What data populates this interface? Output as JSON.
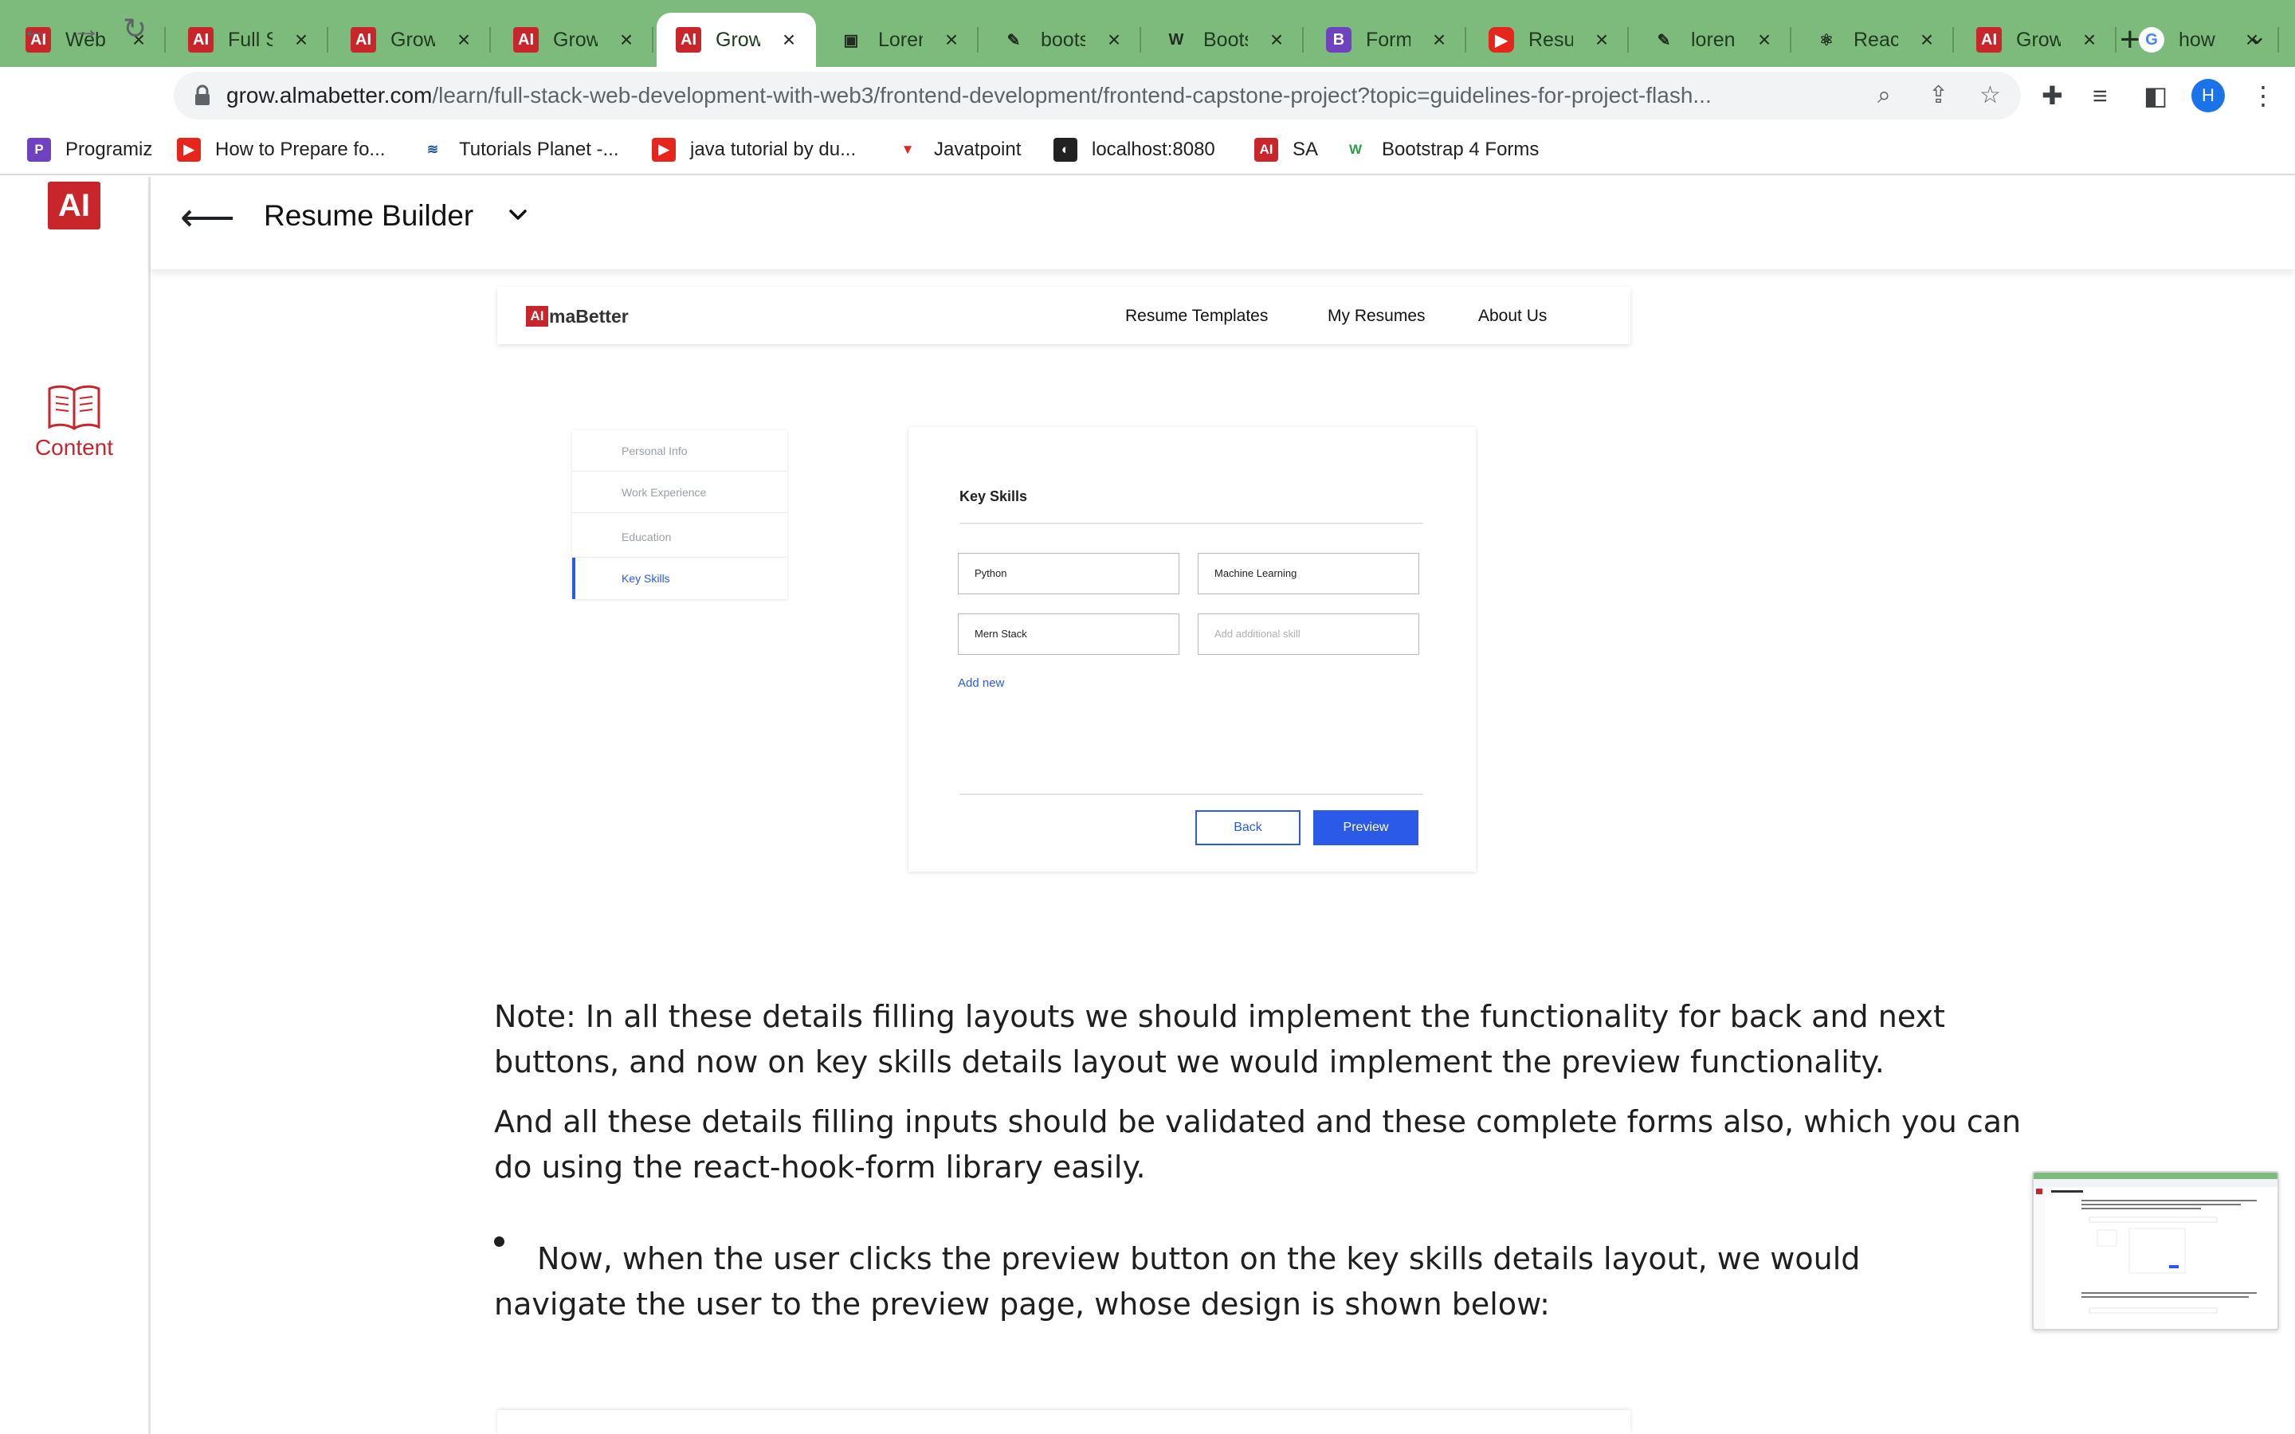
{
  "browser": {
    "tabs": [
      {
        "title": "Web",
        "favicon": "almabetter-icon",
        "fav_text": "AI"
      },
      {
        "title": "Full S",
        "favicon": "almabetter-icon",
        "fav_text": "AI"
      },
      {
        "title": "Grow",
        "favicon": "almabetter-icon",
        "fav_text": "AI"
      },
      {
        "title": "Grow",
        "favicon": "almabetter-icon",
        "fav_text": "AI"
      },
      {
        "title": "Grow",
        "favicon": "almabetter-icon",
        "fav_text": "AI",
        "active": true
      },
      {
        "title": "Loren",
        "favicon": "image-icon",
        "fav_text": "▣"
      },
      {
        "title": "boots",
        "favicon": "pen-icon",
        "fav_text": "✎"
      },
      {
        "title": "Boots",
        "favicon": "w3-icon",
        "fav_text": "W"
      },
      {
        "title": "Form",
        "favicon": "bootstrap-icon",
        "fav_text": "B"
      },
      {
        "title": "Resu",
        "favicon": "youtube-icon",
        "fav_text": "▶"
      },
      {
        "title": "loren",
        "favicon": "pen-icon",
        "fav_text": "✎"
      },
      {
        "title": "Reac",
        "favicon": "react-icon",
        "fav_text": "⚛"
      },
      {
        "title": "Grow",
        "favicon": "almabetter-icon",
        "fav_text": "AI"
      },
      {
        "title": "how",
        "favicon": "google-icon",
        "fav_text": "G"
      }
    ],
    "new_tab_glyph": "+",
    "url_host": "grow.almabetter.com",
    "url_path": "/learn/full-stack-web-development-with-web3/frontend-development/frontend-capstone-project?topic=guidelines-for-project-flash...",
    "profile_initial": "H",
    "bookmarks": [
      {
        "label": "Programiz",
        "icon": "programiz-icon"
      },
      {
        "label": "How to Prepare fo...",
        "icon": "youtube-icon"
      },
      {
        "label": "Tutorials Planet -...",
        "icon": "tutorials-planet-icon"
      },
      {
        "label": "java tutorial by du...",
        "icon": "youtube-icon"
      },
      {
        "label": "Javatpoint",
        "icon": "javatpoint-icon"
      },
      {
        "label": "localhost:8080",
        "icon": "globe-icon"
      },
      {
        "label": "SA",
        "icon": "almabetter-icon"
      },
      {
        "label": "Bootstrap 4 Forms",
        "icon": "w3-icon"
      }
    ]
  },
  "sidebar": {
    "logo_text": "AI",
    "content_label": "Content"
  },
  "header": {
    "title": "Resume Builder"
  },
  "mockup": {
    "logo_badge": "AI",
    "logo_text": "maBetter",
    "nav_links": [
      "Resume Templates",
      "My Resumes",
      "About Us"
    ],
    "steps": [
      "Personal Info",
      "Work Experience",
      "Education",
      "Key Skills"
    ],
    "card_title": "Key Skills",
    "skills": [
      "Python",
      "Machine Learning",
      "Mern Stack"
    ],
    "skill_placeholder": "Add additional skill",
    "add_new": "Add new",
    "back_label": "Back",
    "preview_label": "Preview"
  },
  "article": {
    "note": "Note: In all these details filling layouts we should implement the functionality for back and next buttons, and now on key skills details layout we would implement the preview functionality.",
    "validation": "And all these details filling inputs should be validated and these complete forms also, which you can do using the react-hook-form library easily.",
    "bullet": "Now, when the user clicks the preview button on the key skills details layout, we would navigate the user to the preview page, whose design is shown below:"
  },
  "colors": {
    "tabstrip": "#7dbb7c",
    "brand_red": "#c8262a",
    "mock_blue": "#2b59e8"
  }
}
